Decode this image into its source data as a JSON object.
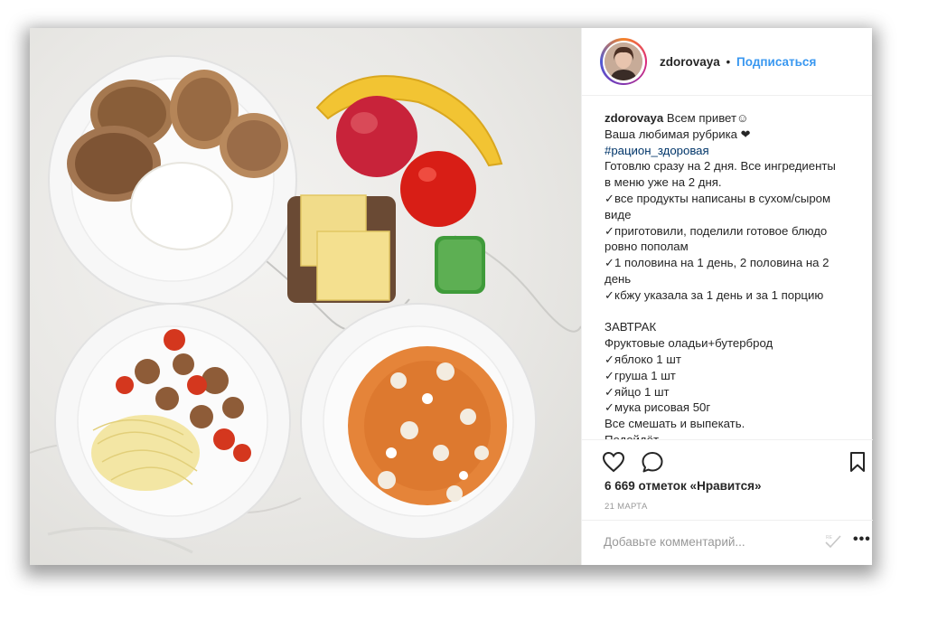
{
  "post": {
    "username": "zdorovaya",
    "separator": "•",
    "follow_label": "Подписаться",
    "caption": {
      "greeting": " Всем привет☺",
      "lines": [
        {
          "text": "Ваша любимая рубрика ❤",
          "type": "text"
        },
        {
          "text": "#рацион_здоровая",
          "type": "tag"
        },
        {
          "text": "Готовлю сразу на 2 дня. Все ингредиенты",
          "type": "text"
        },
        {
          "text": "в меню уже на 2 дня.",
          "type": "text"
        },
        {
          "text": "✓все продукты написаны в сухом/сыром",
          "type": "text"
        },
        {
          "text": "виде",
          "type": "text"
        },
        {
          "text": "✓приготовили, поделили готовое блюдо",
          "type": "text"
        },
        {
          "text": "ровно пополам",
          "type": "text"
        },
        {
          "text": "✓1 половина на 1 день, 2 половина на 2",
          "type": "text"
        },
        {
          "text": "день",
          "type": "text"
        },
        {
          "text": "✓кбжу указала за 1 день и за 1 порцию",
          "type": "text"
        },
        {
          "text": "",
          "type": "blank"
        },
        {
          "text": "ЗАВТРАК",
          "type": "text"
        },
        {
          "text": "Фруктовые оладьи+бутерброд",
          "type": "text"
        },
        {
          "text": "✓яблоко 1 шт",
          "type": "text"
        },
        {
          "text": "✓груша 1 шт",
          "type": "text"
        },
        {
          "text": "✓яйцо 1 шт",
          "type": "text"
        },
        {
          "text": "✓мука рисовая 50г",
          "type": "text"
        },
        {
          "text": "Все смешать и выпекать.",
          "type": "text"
        },
        {
          "text": "Подойдёт",
          "type": "text"
        }
      ]
    },
    "likes_text": "6 669 отметок «Нравится»",
    "date_text": "21 марта",
    "comment_placeholder": "Добавьте комментарий...",
    "icons": {
      "like": "heart-outline-icon",
      "comment": "speech-bubble-icon",
      "save": "bookmark-icon",
      "post": "post-check-icon",
      "more": "ellipsis-icon"
    },
    "colors": {
      "link": "#3897f0",
      "hashtag": "#003569",
      "text": "#262626",
      "muted": "#999999"
    }
  }
}
